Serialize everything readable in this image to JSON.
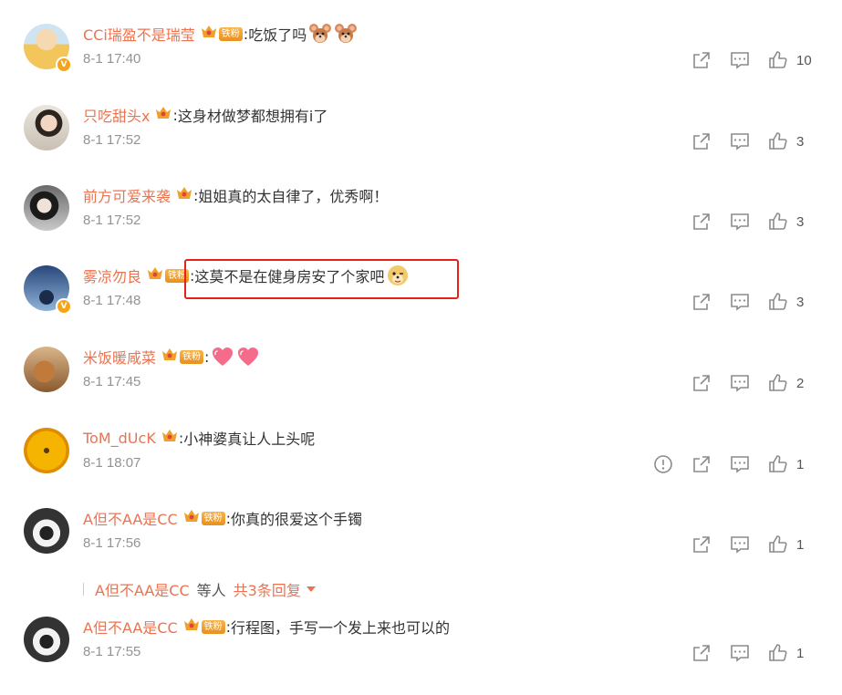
{
  "colors": {
    "username": "#eb7350",
    "time": "#939393",
    "highlight_border": "#e62117",
    "badge": "#f0a02a"
  },
  "fan_badge_label": "铁粉",
  "comments": [
    {
      "user": "CCi瑞盈不是瑞莹",
      "verified": true,
      "fan": true,
      "text": "吃饭了吗",
      "emoji": [
        "jerry-mouse-emoji",
        "jerry-mouse-emoji"
      ],
      "time": "8-1 17:40",
      "likes": "10",
      "report": false
    },
    {
      "user": "只吃甜头x",
      "verified": false,
      "fan": false,
      "text": "这身材做梦都想拥有i了",
      "emoji": [],
      "time": "8-1 17:52",
      "likes": "3",
      "report": false
    },
    {
      "user": "前方可爱来袭",
      "verified": false,
      "fan": false,
      "text": "姐姐真的太自律了，优秀啊！",
      "emoji": [],
      "time": "8-1 17:52",
      "likes": "3",
      "report": false
    },
    {
      "user": "雾凉勿良",
      "verified": true,
      "fan": true,
      "text": "这莫不是在健身房安了个家吧",
      "emoji": [
        "doge-emoji"
      ],
      "time": "8-1 17:48",
      "likes": "3",
      "report": false
    },
    {
      "user": "米饭暖咸菜",
      "verified": false,
      "fan": true,
      "text": "",
      "emoji": [
        "heart-emoji",
        "heart-emoji"
      ],
      "time": "8-1 17:45",
      "likes": "2",
      "report": false
    },
    {
      "user": "ToM_dUcK",
      "verified": false,
      "fan": false,
      "text": "小神婆真让人上头呢",
      "emoji": [],
      "time": "8-1 18:07",
      "likes": "1",
      "report": true
    },
    {
      "user": "A但不AA是CC",
      "verified": false,
      "fan": true,
      "text": "你真的很爱这个手镯",
      "emoji": [],
      "time": "8-1 17:56",
      "likes": "1",
      "report": false
    },
    {
      "user": "A但不AA是CC",
      "verified": false,
      "fan": true,
      "text": "行程图，手写一个发上来也可以的",
      "emoji": [],
      "time": "8-1 17:55",
      "likes": "1",
      "report": false
    }
  ],
  "reply_summary": {
    "who": "A但不AA是CC",
    "suffix": "等人",
    "total": "共3条回复"
  }
}
